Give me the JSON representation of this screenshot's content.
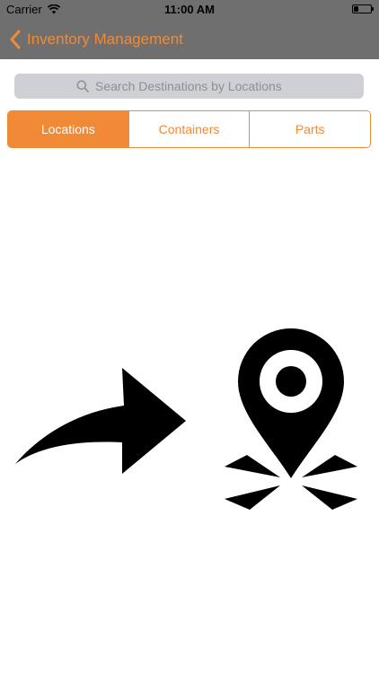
{
  "status_bar": {
    "carrier": "Carrier",
    "time": "11:00 AM",
    "battery_level": 0.25
  },
  "nav": {
    "back_title": "Inventory Management"
  },
  "search": {
    "placeholder": "Search Destinations by Locations",
    "value": ""
  },
  "segments": [
    {
      "label": "Locations",
      "selected": true
    },
    {
      "label": "Containers",
      "selected": false
    },
    {
      "label": "Parts",
      "selected": false
    }
  ],
  "illustration": {
    "icons": [
      "curved-arrow-right-icon",
      "map-pin-target-icon"
    ]
  },
  "colors": {
    "accent": "#f08a37",
    "header": "#6f6f6f",
    "search_bg": "#cfd0d5",
    "icon": "#000000"
  }
}
